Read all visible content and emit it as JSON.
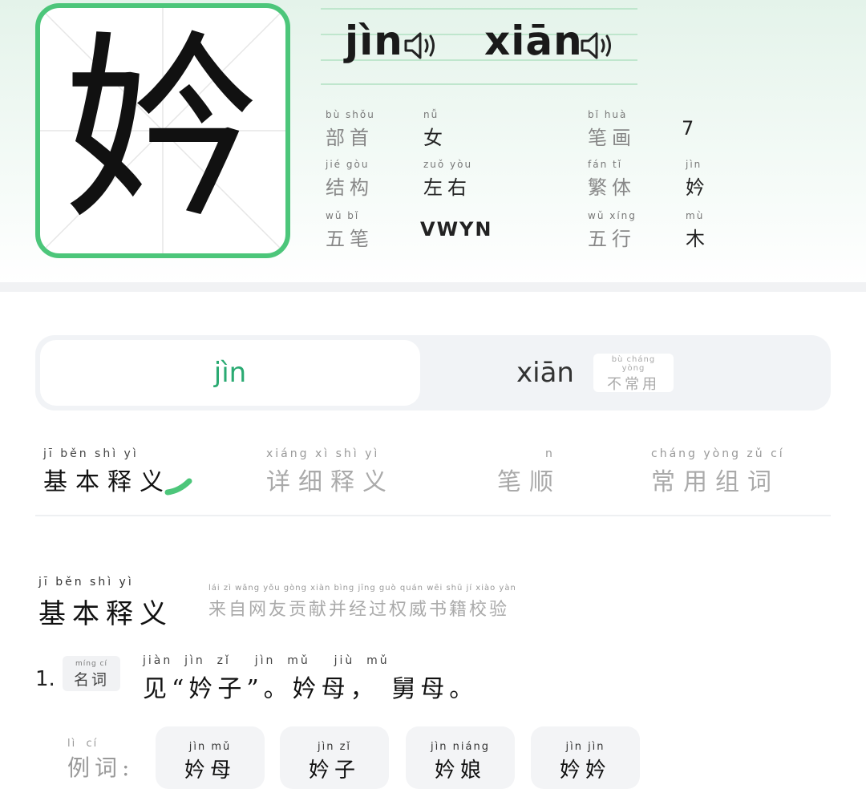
{
  "character": {
    "glyph": "妗"
  },
  "readings": [
    {
      "pinyin": "jìn",
      "speaker_icon": "speaker-icon"
    },
    {
      "pinyin": "xiān",
      "speaker_icon": "speaker-icon"
    }
  ],
  "info": {
    "radical": {
      "label_py": "bù shǒu",
      "label": "部首",
      "value_py": "nǚ",
      "value": "女"
    },
    "strokes": {
      "label_py": "bǐ huà",
      "label": "笔画",
      "value": "7"
    },
    "structure": {
      "label_py": "jié gòu",
      "label": "结构",
      "value_py": "zuǒ yòu",
      "value": "左右"
    },
    "traditional": {
      "label_py": "fán tǐ",
      "label": "繁体",
      "value_py": "jìn",
      "value": "妗"
    },
    "wubi": {
      "label_py": "wǔ bǐ",
      "label": "五笔",
      "value": "VWYN"
    },
    "wuxing": {
      "label_py": "wǔ xíng",
      "label": "五行",
      "value_py": "mù",
      "value": "木"
    }
  },
  "reading_tabs": {
    "active": "jìn",
    "second": "xiān",
    "uncommon_py": "bù cháng yòng",
    "uncommon": "不常用"
  },
  "section_tabs": [
    {
      "py": "jī běn shì yì",
      "label": "基本释义"
    },
    {
      "py": "xiáng xì shì yì",
      "label": "详细释义"
    },
    {
      "py": "n",
      "label": "笔顺"
    },
    {
      "py": "cháng yòng zǔ cí",
      "label": "常用组词"
    }
  ],
  "basic_def": {
    "title_py": "jī běn shì yì",
    "title": "基本释义",
    "source_py": "lái zì wǎng yǒu gòng xiàn bìng jīng guò quán wēi shū jí xiào yàn",
    "source": "来自网友贡献并经过权威书籍校验",
    "items": [
      {
        "num": "1.",
        "pos_py": "míng cí",
        "pos": "名词",
        "text_py": "jiàn  jìn  zǐ    jìn  mǔ    jiù  mǔ",
        "text": "见“妗子”。妗母， 舅母。"
      }
    ]
  },
  "examples": {
    "label_py": "lì  cí",
    "label": "例词:",
    "words": [
      {
        "py": "jìn mǔ",
        "word": "妗母"
      },
      {
        "py": "jìn zǐ",
        "word": "妗子"
      },
      {
        "py": "jìn niáng",
        "word": "妗娘"
      },
      {
        "py": "jìn jìn",
        "word": "妗妗"
      }
    ]
  },
  "colors": {
    "accent": "#4cc67a",
    "active_tab_text": "#2aaa72"
  }
}
